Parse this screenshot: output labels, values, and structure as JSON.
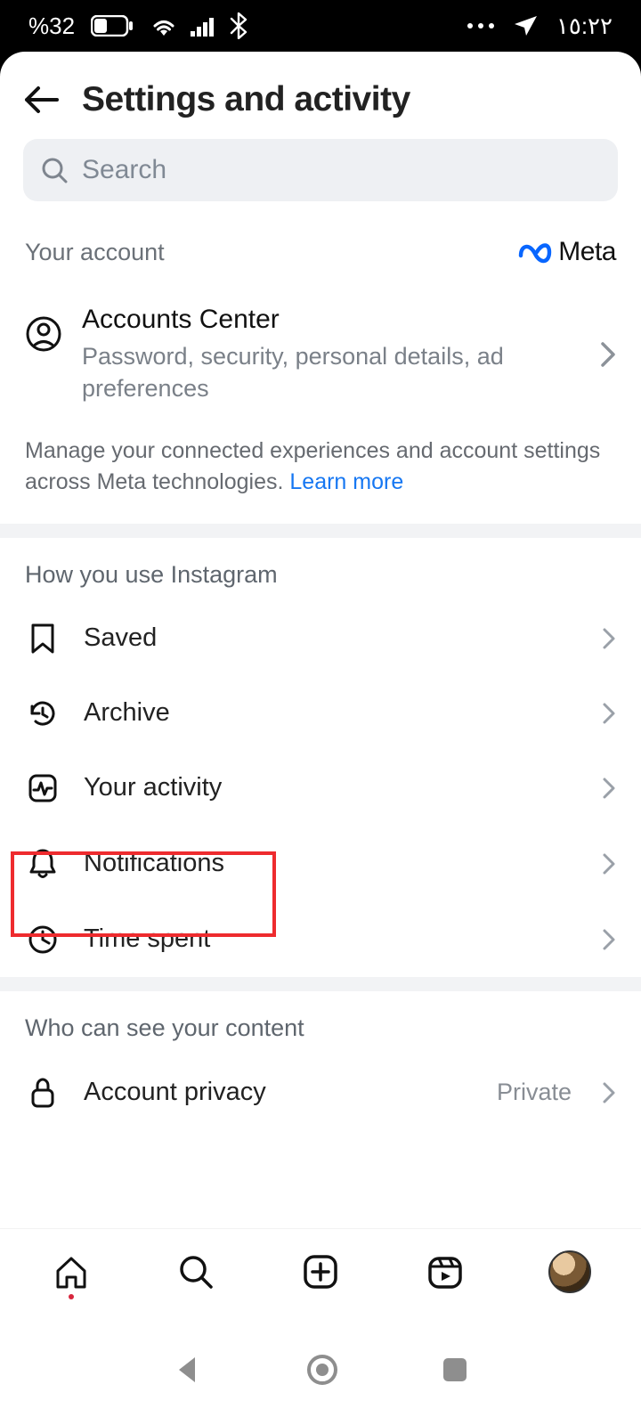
{
  "status": {
    "battery_pct": "%32",
    "time": "١٥:٢٢"
  },
  "header": {
    "title": "Settings and activity"
  },
  "search": {
    "placeholder": "Search"
  },
  "your_account": {
    "heading": "Your account",
    "brand": "Meta",
    "center_title": "Accounts Center",
    "center_subtitle": "Password, security, personal details, ad preferences",
    "desc_lead": "Manage your connected experiences and account settings across Meta technologies. ",
    "learn_more": "Learn more"
  },
  "how_use": {
    "heading": "How you use Instagram",
    "items": [
      {
        "label": "Saved"
      },
      {
        "label": "Archive"
      },
      {
        "label": "Your activity"
      },
      {
        "label": "Notifications"
      },
      {
        "label": "Time spent"
      }
    ]
  },
  "who_see": {
    "heading": "Who can see your content",
    "items": [
      {
        "label": "Account privacy",
        "value": "Private"
      }
    ]
  },
  "highlight": {
    "target_label": "Your activity"
  }
}
